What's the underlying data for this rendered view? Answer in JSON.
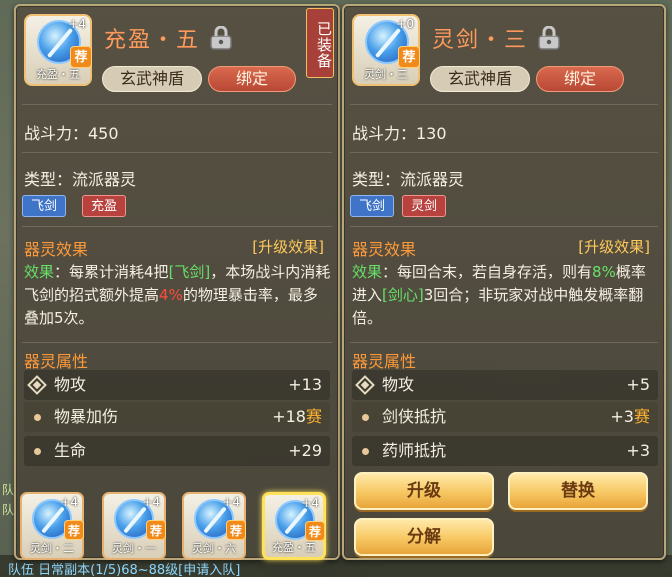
{
  "left_card": {
    "icon": {
      "plus": "+4",
      "badge": "荐",
      "caption": "充盈・五",
      "icon_name": "sword-gem-icon"
    },
    "title": "充盈・五",
    "equipped_label": "已装备",
    "school_tag": "玄武神盾",
    "bind_tag": "绑定",
    "power": "战斗力：450",
    "type": "类型：流派器灵",
    "chips": [
      "飞剑",
      "充盈"
    ],
    "effect_section_title": "器灵效果",
    "upgrade_effect_label": "[升级效果]",
    "effect": {
      "prefix": "效果",
      "p1": "：每累计消耗4把",
      "link1": "[飞剑]",
      "p2": "，本场战斗内消耗飞剑的招式额外提高",
      "pct": "4%",
      "p3": "的物理暴击率，最多叠加5次。"
    },
    "attr_section_title": "器灵属性",
    "attrs": [
      {
        "name": "物攻",
        "value": "+13",
        "suffix": ""
      },
      {
        "name": "物暴加伤",
        "value": "+18",
        "suffix": "赛"
      },
      {
        "name": "生命",
        "value": "+29",
        "suffix": ""
      }
    ]
  },
  "right_card": {
    "icon": {
      "plus": "+0",
      "badge": "荐",
      "caption": "灵剑・三",
      "icon_name": "sword-gem-icon"
    },
    "title": "灵剑・三",
    "school_tag": "玄武神盾",
    "bind_tag": "绑定",
    "power": "战斗力：130",
    "type": "类型：流派器灵",
    "chips": [
      "飞剑",
      "灵剑"
    ],
    "effect_section_title": "器灵效果",
    "upgrade_effect_label": "[升级效果]",
    "effect": {
      "prefix": "效果",
      "p1": "：每回合末，若自身存活，则有",
      "pct": "8%",
      "p2": "概率进入",
      "link1": "[剑心]",
      "p3": "3回合；非玩家对战中触发概率翻倍。"
    },
    "attr_section_title": "器灵属性",
    "attrs": [
      {
        "name": "物攻",
        "value": "+5",
        "suffix": ""
      },
      {
        "name": "剑侠抵抗",
        "value": "+3",
        "suffix": "赛"
      },
      {
        "name": "药师抵抗",
        "value": "+3",
        "suffix": ""
      }
    ],
    "buttons": {
      "upgrade": "升级",
      "replace": "替换",
      "decompose": "分解"
    }
  },
  "slots": [
    {
      "plus": "+4",
      "badge": "荐",
      "caption": "灵剑・二"
    },
    {
      "plus": "+4",
      "badge": "荐",
      "caption": "灵剑・一"
    },
    {
      "plus": "+4",
      "badge": "荐",
      "caption": "灵剑・六"
    },
    {
      "plus": "+4",
      "badge": "荐",
      "caption": "充盈・五"
    }
  ],
  "background_text": {
    "bottom_line": "队伍 日常副本(1/5)68~88级[申请入队]"
  },
  "colors": {
    "title_orange": "#ff9a5a",
    "section_orange": "#ff9a3a",
    "effect_green": "#68e068",
    "pct_red": "#ff4c3a",
    "button_gold": "#f7c762"
  }
}
